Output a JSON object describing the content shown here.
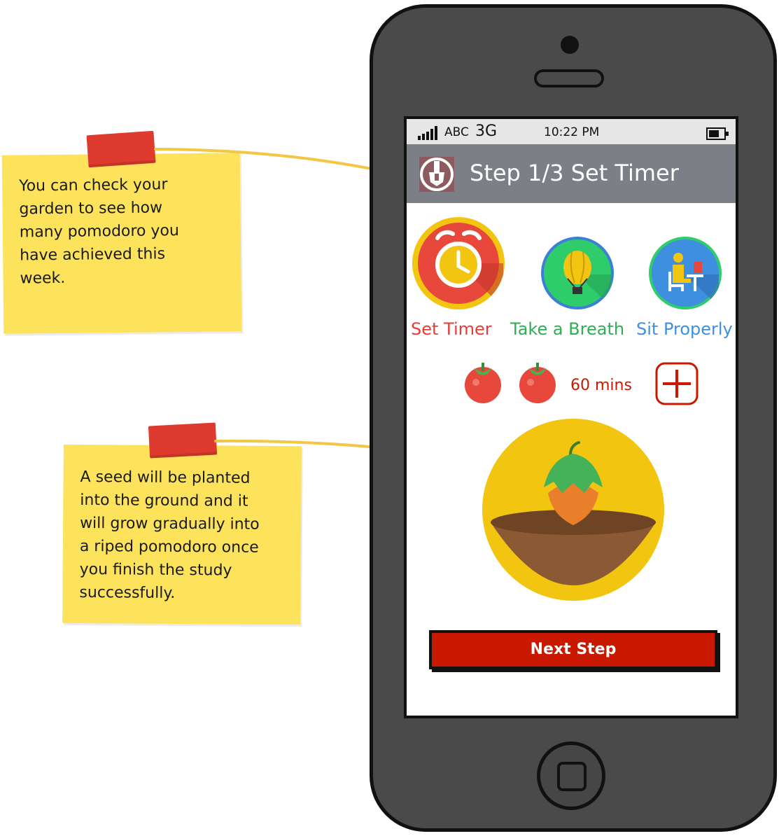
{
  "notes": [
    {
      "text": "You can check your\ngarden to see how\nmany pomodoro you\nhave achieved this\nweek."
    },
    {
      "text": "A seed will be planted\ninto the ground and it\nwill grow gradually into\na riped pomodoro once\nyou finish the study\nsuccessfully."
    }
  ],
  "status": {
    "carrier": "ABC",
    "network": "3G",
    "time": "10:22 PM"
  },
  "header": {
    "title": "Step 1/3 Set Timer",
    "icon": "shovel-icon"
  },
  "steps": [
    {
      "label": "Set Timer",
      "icon": "alarm-clock-icon",
      "color": "#e53d36"
    },
    {
      "label": "Take a Breath",
      "icon": "hot-air-balloon-icon",
      "color": "#2fae53"
    },
    {
      "label": "Sit Properly",
      "icon": "person-sitting-icon",
      "color": "#3f8fe0"
    }
  ],
  "timer": {
    "pomodoro_count": 2,
    "duration": "60 mins",
    "add_icon": "plus-icon"
  },
  "garden": {
    "icon": "seed-sprout-icon"
  },
  "next_button": "Next Step",
  "colors": {
    "accent_red": "#c91900",
    "header_gray": "#7c7f86",
    "note_yellow": "#fde35b",
    "garden_yellow": "#f2c511"
  }
}
